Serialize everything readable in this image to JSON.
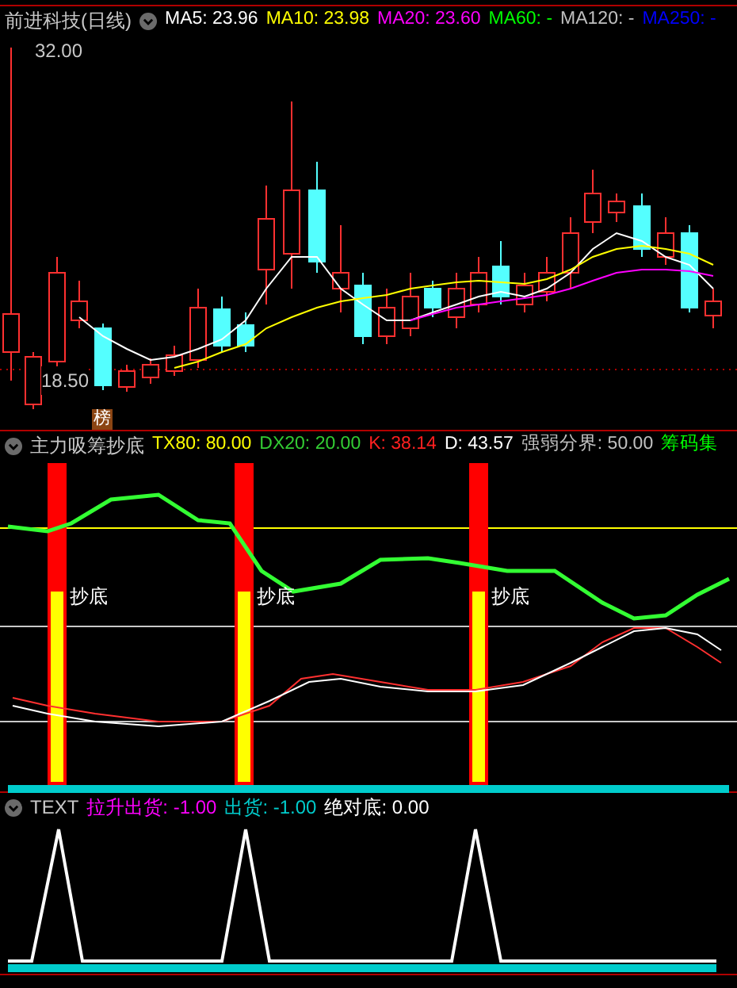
{
  "main_panel": {
    "title": "前进科技(日线)",
    "indicators": [
      {
        "label": "MA5: 23.96",
        "color": "#ffffff"
      },
      {
        "label": "MA10: 23.98",
        "color": "#ffff00"
      },
      {
        "label": "MA20: 23.60",
        "color": "#ff00ff"
      },
      {
        "label": "MA60: -",
        "color": "#00ff00"
      },
      {
        "label": "MA120: -",
        "color": "#c0c0c0"
      },
      {
        "label": "MA250: -",
        "color": "#0000ff"
      }
    ],
    "high_label": "32.00",
    "low_label": "18.50",
    "badge": "榜"
  },
  "indicator_panel": {
    "title": "主力吸筹抄底",
    "values": [
      {
        "label": "TX80: 80.00",
        "color": "#ffff00"
      },
      {
        "label": "DX20: 20.00",
        "color": "#33cc33"
      },
      {
        "label": "K: 38.14",
        "color": "#ff2020"
      },
      {
        "label": "D: 43.57",
        "color": "#ffffff"
      },
      {
        "label": "强弱分界: 50.00",
        "color": "#c0c0c0"
      },
      {
        "label": "筹码集",
        "color": "#00ff00"
      }
    ],
    "signal_labels": [
      "抄底",
      "抄底",
      "抄底"
    ]
  },
  "text_panel": {
    "title": "TEXT",
    "values": [
      {
        "label": "拉升出货: -1.00",
        "color": "#ff00ff"
      },
      {
        "label": "出货: -1.00",
        "color": "#00cccc"
      },
      {
        "label": "绝对底: 0.00",
        "color": "#ffffff"
      }
    ]
  }
}
